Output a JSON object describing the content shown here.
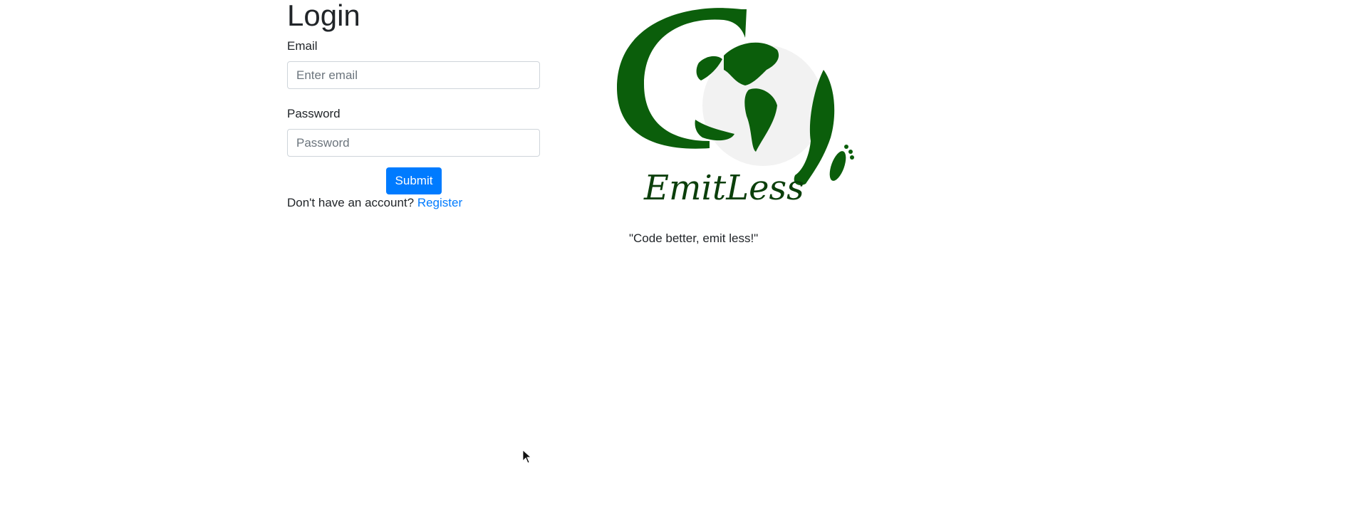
{
  "login": {
    "title": "Login",
    "email_label": "Email",
    "email_placeholder": "Enter email",
    "password_label": "Password",
    "password_placeholder": "Password",
    "submit_label": "Submit",
    "register_prompt": "Don't have an account?",
    "register_link": "Register"
  },
  "brand": {
    "logo_text": "EmitLess",
    "tagline": "\"Code better, emit less!\""
  },
  "colors": {
    "primary": "#007bff",
    "logo_green": "#0b5e0b",
    "text": "#212529"
  },
  "icons": [
    "mouse-cursor-icon"
  ]
}
